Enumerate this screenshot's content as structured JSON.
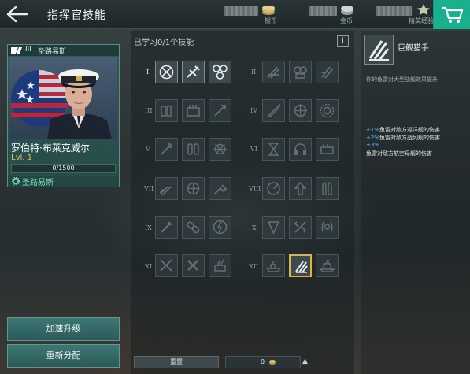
{
  "header": {
    "title": "指挥官技能",
    "currencies": [
      {
        "label": "银币",
        "icon": "silver-coin-icon"
      },
      {
        "label": "金币",
        "icon": "gold-coin-icon"
      },
      {
        "label": "精英经验",
        "icon": "elite-xp-star-icon"
      }
    ]
  },
  "commander": {
    "rank": "III",
    "nation": "圣路易斯",
    "name": "罗伯特·布莱克威尔",
    "level": "Lvl. 1",
    "xp": "0/1500",
    "footer_nation": "圣路易斯"
  },
  "actions": {
    "accelerate": "加速升级",
    "reassign": "重新分配"
  },
  "skills_panel": {
    "learned": "已学习0/1个技能",
    "info": "i",
    "reset": "重置",
    "points": "0"
  },
  "tiers": [
    "I",
    "II",
    "III",
    "IV",
    "V",
    "VI",
    "VII",
    "VIII",
    "IX",
    "X",
    "XI",
    "XII"
  ],
  "selected_skill": {
    "name": "巨舰猎手",
    "description": "你的鱼雷对大型战舰效果提升",
    "bonuses": [
      {
        "value": "+1%",
        "text": "鱼雷对敌方巡洋舰的伤害"
      },
      {
        "value": "+2%",
        "text": "鱼雷对敌方战列舰的伤害"
      },
      {
        "value": "+3%",
        "text": ""
      },
      {
        "value": "",
        "text": "鱼雷对敌方航空母舰的伤害"
      }
    ]
  },
  "colors": {
    "accent": "#1bb08d",
    "selected_border": "#e2b33a",
    "level": "#f0c23c",
    "bonus_value": "#5fc4ff"
  }
}
